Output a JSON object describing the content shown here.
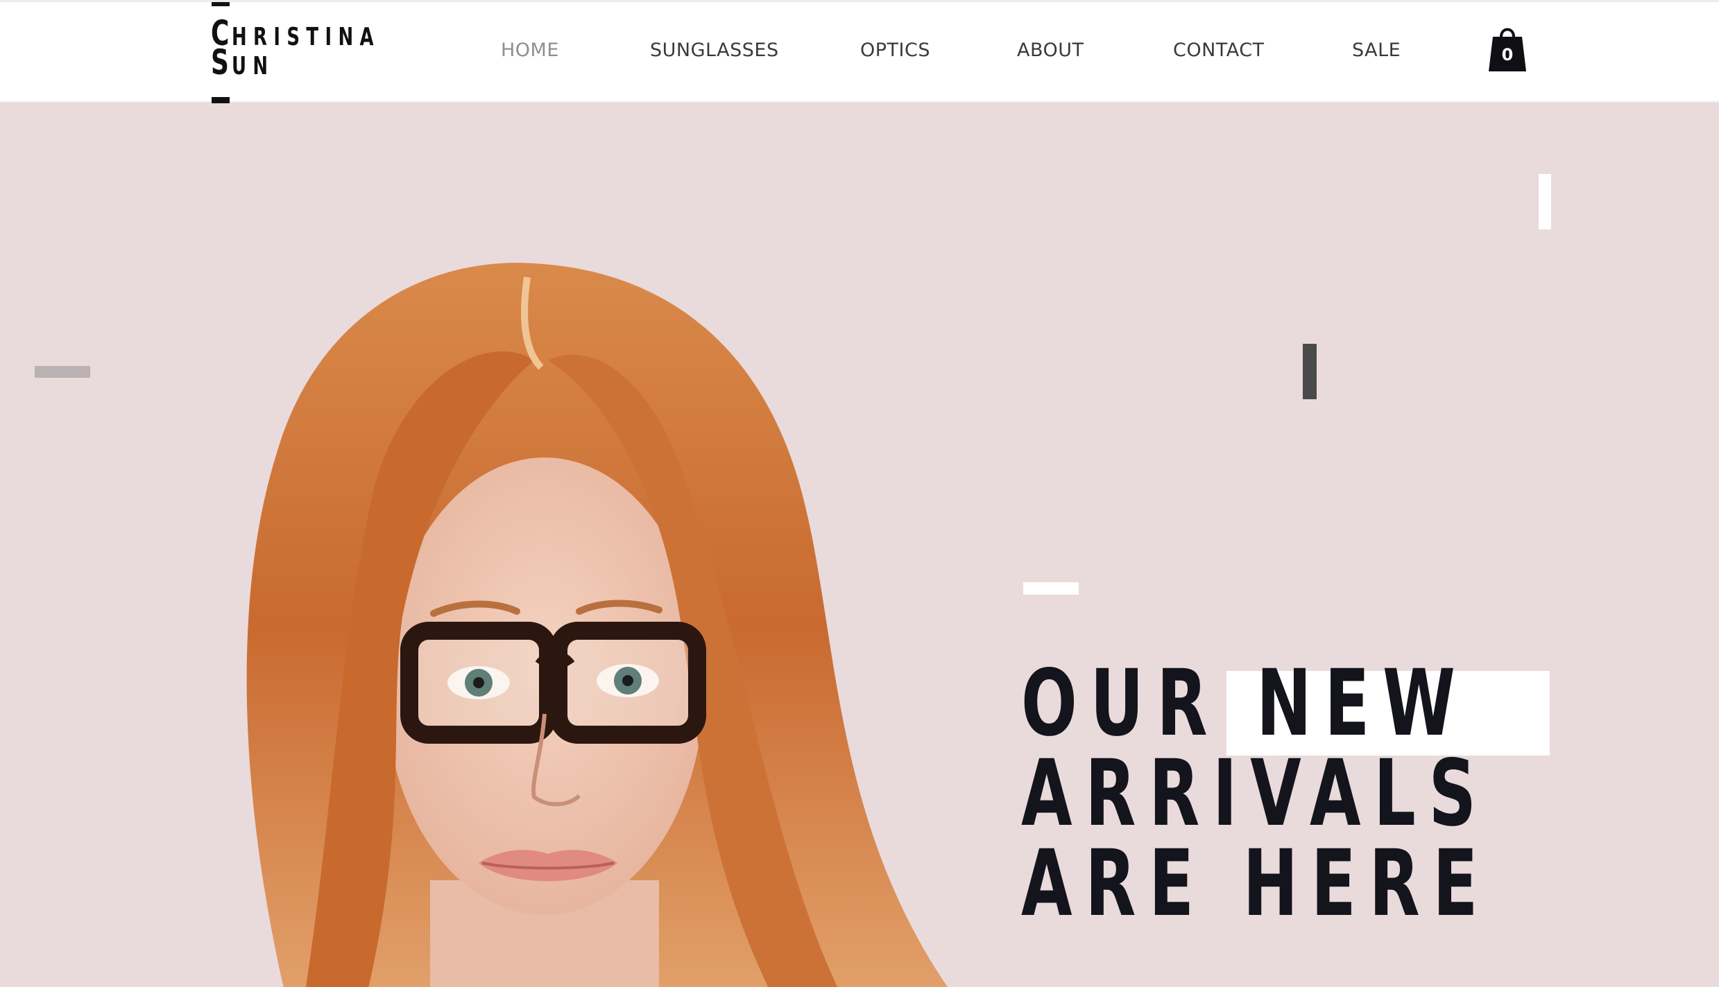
{
  "logo": {
    "line1_first": "C",
    "line1_rest": "HRISTINA",
    "line2_first": "S",
    "line2_rest": "UN"
  },
  "nav": {
    "items": [
      {
        "label": "HOME",
        "active": true
      },
      {
        "label": "SUNGLASSES",
        "active": false
      },
      {
        "label": "OPTICS",
        "active": false
      },
      {
        "label": "ABOUT",
        "active": false
      },
      {
        "label": "CONTACT",
        "active": false
      },
      {
        "label": "SALE",
        "active": false
      }
    ]
  },
  "cart": {
    "icon": "shopping-bag-icon",
    "count": "0"
  },
  "hero": {
    "image": "woman-with-glasses-portrait",
    "headline": {
      "line1": "OUR NEW",
      "line2": "ARRIVALS",
      "line3": "ARE HERE"
    }
  },
  "colors": {
    "hero_background": "#e9dadc",
    "headline_text": "#13141c",
    "nav_text": "#3a3a3a",
    "nav_active": "#8f8f8f",
    "hair": "#c96a30"
  }
}
